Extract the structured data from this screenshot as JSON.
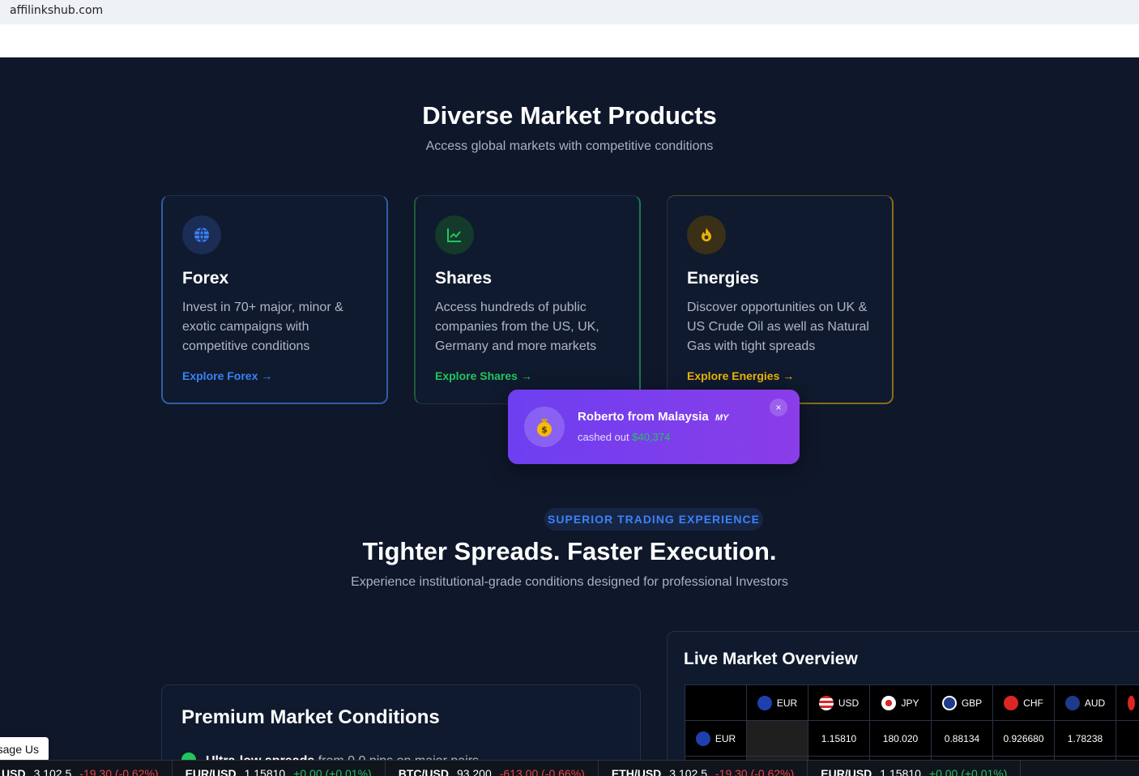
{
  "browser": {
    "url": "affilinkshub.com"
  },
  "markets": {
    "title": "Diverse Market Products",
    "subtitle": "Access global markets with competitive conditions",
    "cards": [
      {
        "icon": "globe-icon",
        "title": "Forex",
        "description": "Invest in 70+ major, minor & exotic campaigns with competitive conditions",
        "link": "Explore Forex →",
        "accent": "#3b82f6"
      },
      {
        "icon": "chart-line-icon",
        "title": "Shares",
        "description": "Access hundreds of public companies from the US, UK, Germany and more markets",
        "link": "Explore Shares →",
        "accent": "#22c55e"
      },
      {
        "icon": "fire-icon",
        "title": "Energies",
        "description": "Discover opportunities on UK & US Crude Oil as well as Natural Gas with tight spreads",
        "link": "Explore Energies →",
        "accent": "#eab308"
      }
    ]
  },
  "toast": {
    "name": "Roberto from Malaysia",
    "country_code": "MY",
    "prefix": "cashed out",
    "amount": "$40,374",
    "close": "×"
  },
  "trading": {
    "badge": "SUPERIOR TRADING EXPERIENCE",
    "title": "Tighter Spreads. Faster Execution.",
    "subtitle": "Experience institutional-grade conditions designed for professional Investors"
  },
  "premium": {
    "title": "Premium Market Conditions",
    "item_bold": "Ultra-low spreads",
    "item_rest": "from 0.0 pips on major pairs"
  },
  "live_market": {
    "title": "Live Market Overview",
    "headers": [
      "EUR",
      "USD",
      "JPY",
      "GBP",
      "CHF",
      "AUD"
    ],
    "row_label": "EUR",
    "row_values": [
      "",
      "1.15810",
      "180.020",
      "0.88134",
      "0.926680",
      "1.78238"
    ]
  },
  "message_button": "Message Us",
  "ticker": [
    {
      "symbol": "USD",
      "price": "3,102.5",
      "change": "-19.30 (-0.62%)",
      "dir": "neg"
    },
    {
      "symbol": "EUR/USD",
      "price": "1.15810",
      "change": "+0.00 (+0.01%)",
      "dir": "pos"
    },
    {
      "symbol": "BTC/USD",
      "price": "93,200",
      "change": "-613.00 (-0.66%)",
      "dir": "neg"
    },
    {
      "symbol": "ETH/USD",
      "price": "3,102.5",
      "change": "-19.30 (-0.62%)",
      "dir": "neg"
    },
    {
      "symbol": "EUR/USD",
      "price": "1.15810",
      "change": "+0.00 (+0.01%)",
      "dir": "pos"
    }
  ]
}
